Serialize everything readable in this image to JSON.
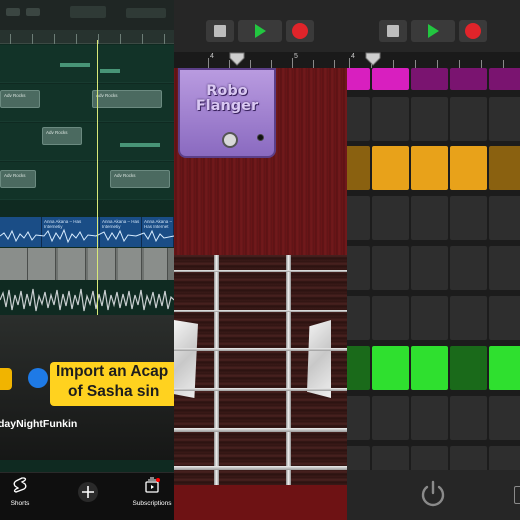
{
  "panel_youtube": {
    "caption_line1": "Import an Acap",
    "caption_line2": "of Sasha sin",
    "hashtag": "dayNightFunkin",
    "nav": [
      {
        "label": "Shorts",
        "icon": "shorts-icon"
      },
      {
        "label": "",
        "icon": "plus-icon"
      },
      {
        "label": "Subscriptions",
        "icon": "subscriptions-icon"
      }
    ],
    "daw_regions": [
      "Adv Rocks",
      "Adv Rocks",
      "Adv Rocks",
      "Adv Rocks",
      "Adv Rocks"
    ],
    "audio_regions": [
      "Anna Akana – Has Internetiy",
      "Anna Akana – Has Internetiy",
      "Anna Akana – Has Internet"
    ],
    "accent": "#ffd21f"
  },
  "panel_guitar": {
    "transport": [
      "stop-icon",
      "play-icon",
      "record-icon"
    ],
    "ruler_numbers": [
      "4",
      "5"
    ],
    "pedal_name_line1": "Robo",
    "pedal_name_line2": "Flanger",
    "pedal_color": "#a688d4"
  },
  "panel_loops": {
    "transport": [
      "stop-icon",
      "play-icon",
      "record-icon"
    ],
    "ruler_numbers": [
      "4"
    ],
    "colors": {
      "pink": "#d81fbf",
      "amber": "#e8a21a",
      "green": "#2fe02f"
    },
    "footer_icon": "power-icon"
  }
}
